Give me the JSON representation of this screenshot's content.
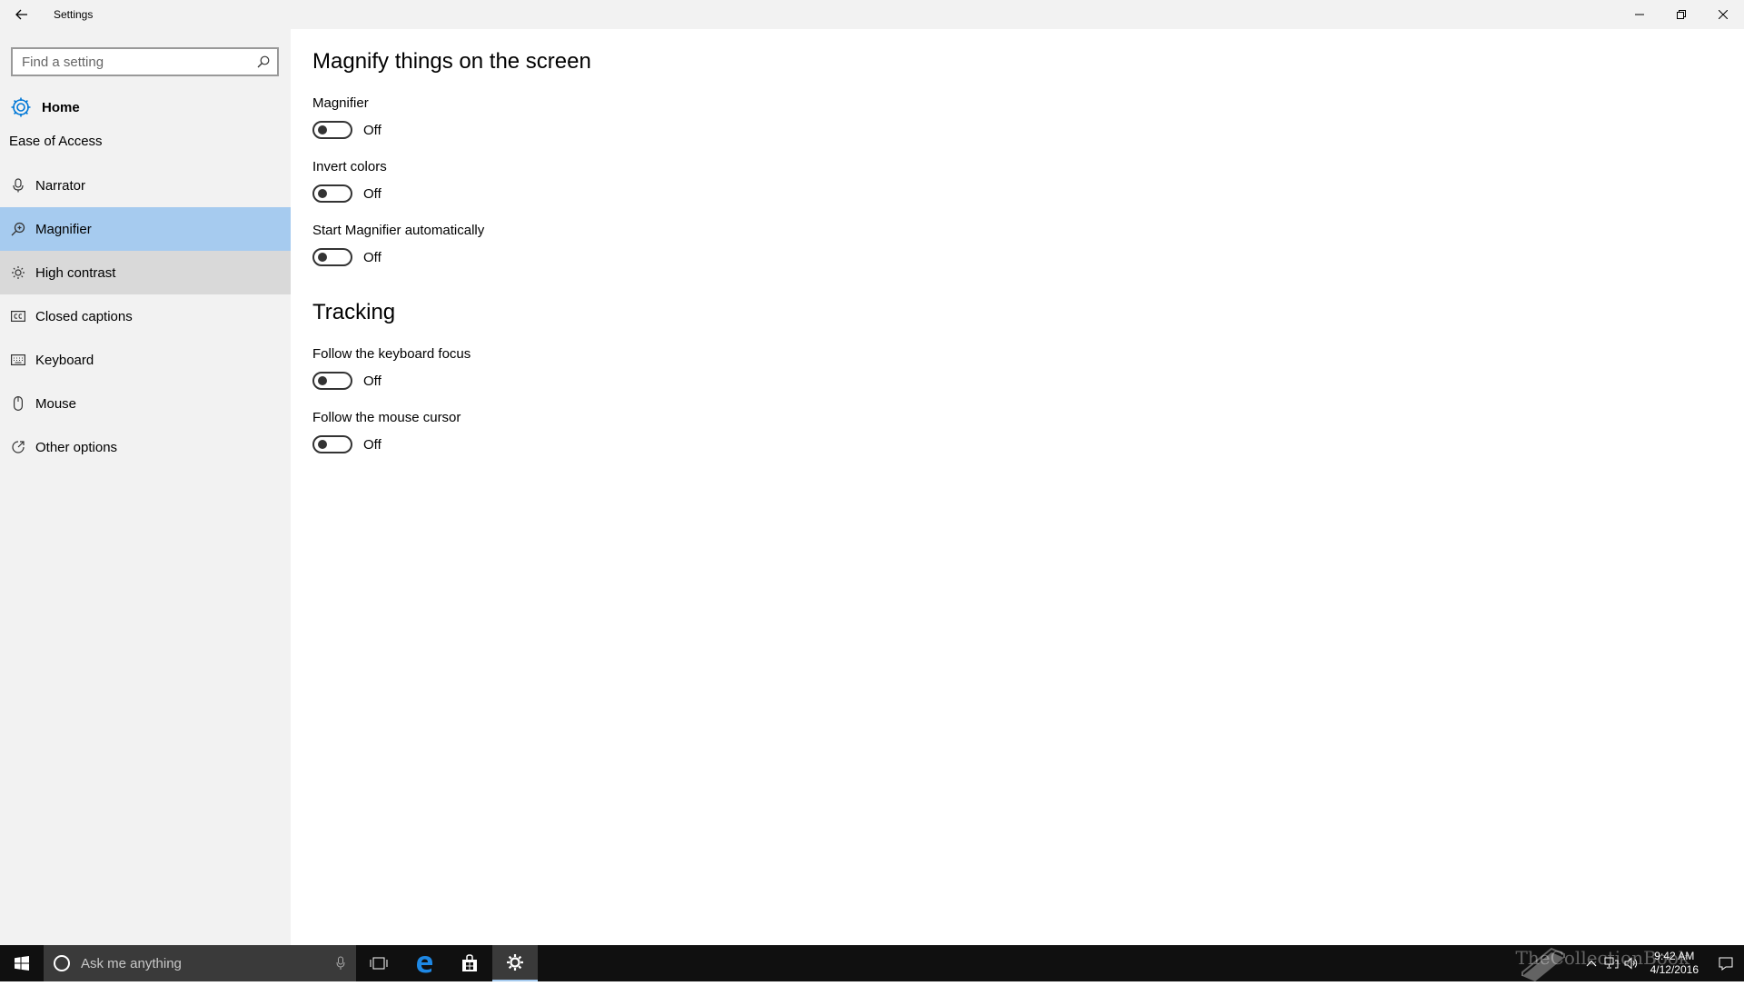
{
  "window": {
    "title": "Settings",
    "back_icon": "back-arrow-icon",
    "controls": [
      "minimize-icon",
      "restore-icon",
      "close-icon"
    ]
  },
  "sidebar": {
    "search": {
      "placeholder": "Find a setting",
      "value": ""
    },
    "home_label": "Home",
    "section_label": "Ease of Access",
    "items": [
      {
        "label": "Narrator",
        "icon": "microphone-icon",
        "state": "normal"
      },
      {
        "label": "Magnifier",
        "icon": "magnifier-icon",
        "state": "selected"
      },
      {
        "label": "High contrast",
        "icon": "sun-icon",
        "state": "hover"
      },
      {
        "label": "Closed captions",
        "icon": "closed-captions-icon",
        "state": "normal"
      },
      {
        "label": "Keyboard",
        "icon": "keyboard-icon",
        "state": "normal"
      },
      {
        "label": "Mouse",
        "icon": "mouse-icon",
        "state": "normal"
      },
      {
        "label": "Other options",
        "icon": "other-options-icon",
        "state": "normal"
      }
    ]
  },
  "main": {
    "magnify_heading": "Magnify things on the screen",
    "magnify_settings": [
      {
        "label": "Magnifier",
        "state": "Off"
      },
      {
        "label": "Invert colors",
        "state": "Off"
      },
      {
        "label": "Start Magnifier automatically",
        "state": "Off"
      }
    ],
    "tracking_heading": "Tracking",
    "tracking_settings": [
      {
        "label": "Follow the keyboard focus",
        "state": "Off"
      },
      {
        "label": "Follow the mouse cursor",
        "state": "Off"
      }
    ]
  },
  "taskbar": {
    "search_placeholder": "Ask me anything",
    "time": "9:42 AM",
    "date": "4/12/2016",
    "watermark": "TheCollectionBook"
  },
  "colors": {
    "sidebar_bg": "#f2f2f2",
    "selected_bg": "#a6cbef",
    "hover_bg": "#d9d9d9",
    "taskbar_bg": "#101010",
    "accent": "#0078d7"
  }
}
